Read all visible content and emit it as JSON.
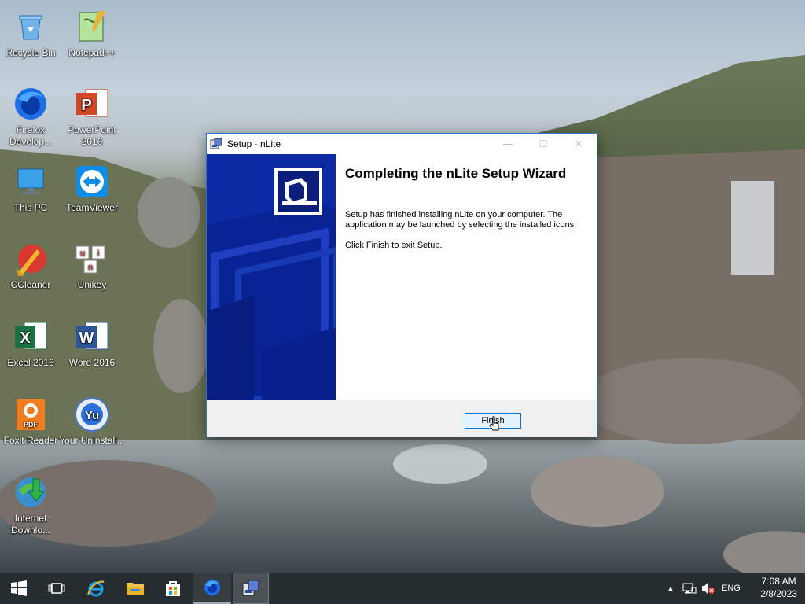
{
  "desktop_icons": [
    {
      "name": "recycle-bin-icon",
      "label": "Recycle Bin"
    },
    {
      "name": "notepad-plus-icon",
      "label": "Notepad++"
    },
    {
      "name": "firefox-dev-icon",
      "label": "Firefox Develop..."
    },
    {
      "name": "powerpoint-icon",
      "label": "PowerPoint 2016"
    },
    {
      "name": "this-pc-icon",
      "label": "This PC"
    },
    {
      "name": "teamviewer-icon",
      "label": "TeamViewer"
    },
    {
      "name": "ccleaner-icon",
      "label": "CCleaner"
    },
    {
      "name": "unikey-icon",
      "label": "Unikey"
    },
    {
      "name": "excel-icon",
      "label": "Excel 2016"
    },
    {
      "name": "word-icon",
      "label": "Word 2016"
    },
    {
      "name": "foxit-reader-icon",
      "label": "Foxit Reader"
    },
    {
      "name": "your-uninstaller-icon",
      "label": "Your Uninstall..."
    },
    {
      "name": "internet-download-icon",
      "label": "Internet Downlo..."
    }
  ],
  "window": {
    "title": "Setup - nLite",
    "heading": "Completing the nLite Setup Wizard",
    "paragraph1": "Setup has finished installing nLite on your computer. The application may be launched by selecting the installed icons.",
    "paragraph2": "Click Finish to exit Setup.",
    "finish_label": "Finish",
    "minimize_glyph": "—",
    "maximize_glyph": "☐",
    "close_glyph": "✕"
  },
  "taskbar": {
    "items": [
      "start-button",
      "task-view",
      "internet-explorer",
      "file-explorer",
      "store",
      "firefox-dev",
      "nlite-setup"
    ],
    "active_item": "nlite-setup"
  },
  "tray": {
    "overflow_glyph": "▲",
    "language": "ENG",
    "time": "7:08 AM",
    "date": "2/8/2023"
  },
  "colors": {
    "window_border": "#2b78c5",
    "sidepanel": "#0a2a9e",
    "finish_border": "#0078d7",
    "taskbar": "#1c2428"
  }
}
